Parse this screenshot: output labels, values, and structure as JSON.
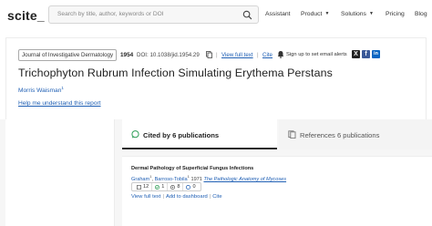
{
  "header": {
    "logo": "scite_",
    "search_placeholder": "Search by title, author, keywords or DOI",
    "nav": [
      {
        "label": "Assistant"
      },
      {
        "label": "Product"
      },
      {
        "label": "Solutions"
      },
      {
        "label": "Pricing"
      },
      {
        "label": "Blog"
      }
    ]
  },
  "paper": {
    "journal": "Journal of Investigative Dermatology",
    "year": "1954",
    "doi": "DOI: 10.1038/jid.1954.29",
    "view_full_text": "View full text",
    "cite": "Cite",
    "alert": "Sign up to set email alerts",
    "title": "Trichophyton Rubrum Infection Simulating Erythema Perstans",
    "author": "Morris Waisman",
    "author_sup": "1",
    "help": "Help me understand this report"
  },
  "tabs": {
    "cited_by": "Cited by 6 publications",
    "references": "References 6 publications"
  },
  "citing": {
    "title": "Dermal Pathology of Superficial Fungus Infections",
    "author1": "Graham",
    "author1_sup": "1",
    "sep": ",",
    "author2": "Barroso-Tobila",
    "author2_sup": "1",
    "year": "1971",
    "journal": "The Pathologic Anatomy of Mycoses",
    "counts": {
      "total": "12",
      "supporting": "1",
      "mentioning": "8",
      "contrasting": "0"
    },
    "view_full_text": "View full text",
    "add_dashboard": "Add to dashboard",
    "cite": "Cite"
  },
  "colors": {
    "link": "#1f5fb4",
    "twitter": "#222222",
    "facebook": "#3b5998",
    "linkedin": "#0a66c2"
  }
}
